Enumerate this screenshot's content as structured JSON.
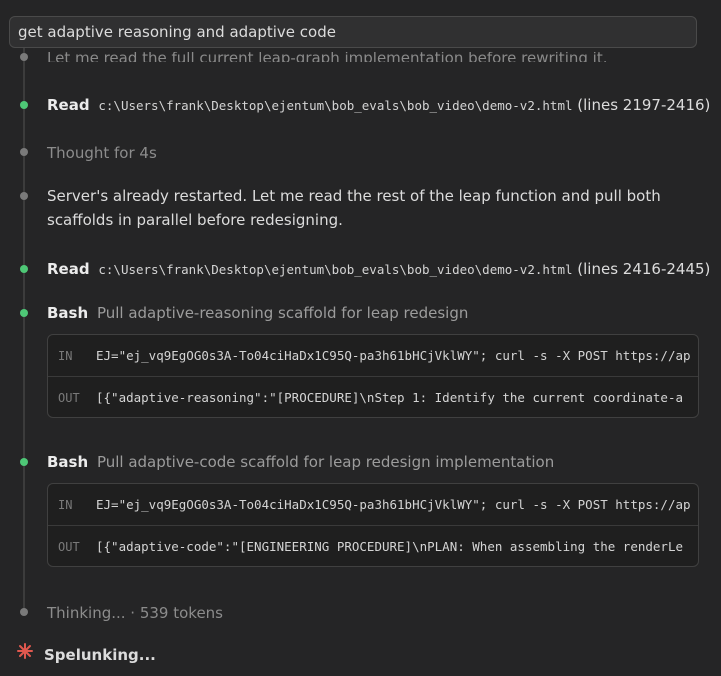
{
  "prompt": {
    "text": "get adaptive reasoning and adaptive code"
  },
  "steps": {
    "partial": "Let me read the full current leap-graph implementation before rewriting it.",
    "read1": {
      "tool": "Read",
      "path": "c:\\Users\\frank\\Desktop\\ejentum\\bob_evals\\bob_video\\demo-v2.html",
      "range": "(lines 2197-2416)"
    },
    "thought": "Thought for 4s",
    "message": "Server's already restarted. Let me read the rest of the leap function and pull both scaffolds in parallel before redesigning.",
    "read2": {
      "tool": "Read",
      "path": "c:\\Users\\frank\\Desktop\\ejentum\\bob_evals\\bob_video\\demo-v2.html",
      "range": "(lines 2416-2445)"
    },
    "bash1": {
      "tool": "Bash",
      "desc": "Pull adaptive-reasoning scaffold for leap redesign",
      "in_label": "IN",
      "in": "EJ=\"ej_vq9EgOG0s3A-To04ciHaDx1C95Q-pa3h61bHCjVklWY\"; curl -s -X POST https://ap",
      "out_label": "OUT",
      "out": "[{\"adaptive-reasoning\":\"[PROCEDURE]\\nStep 1: Identify the current coordinate-a"
    },
    "bash2": {
      "tool": "Bash",
      "desc": "Pull adaptive-code scaffold for leap redesign implementation",
      "in_label": "IN",
      "in": "EJ=\"ej_vq9EgOG0s3A-To04ciHaDx1C95Q-pa3h61bHCjVklWY\"; curl -s -X POST https://ap",
      "out_label": "OUT",
      "out": "[{\"adaptive-code\":\"[ENGINEERING PROCEDURE]\\nPLAN: When assembling the renderLe"
    },
    "thinking": "Thinking... · 539 tokens"
  },
  "status": {
    "text": "Spelunking...",
    "accent": "#e0584e"
  },
  "colors": {
    "green_dot": "#4ec776",
    "gray_dot": "#7a7a7a",
    "background": "#252526"
  }
}
